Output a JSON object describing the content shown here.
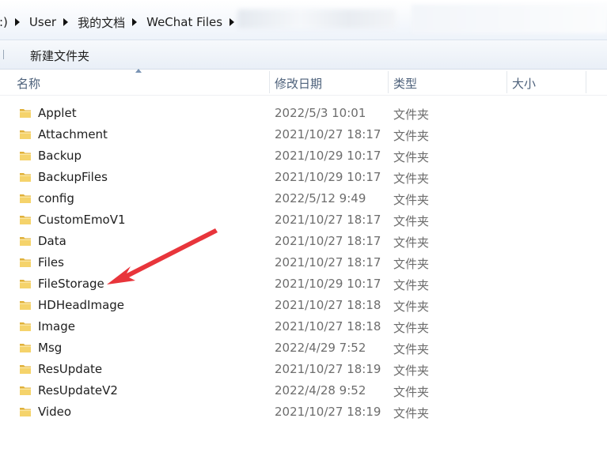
{
  "address_bar": {
    "crumbs": [
      ":)",
      "User",
      "我的文档",
      "WeChat Files"
    ]
  },
  "toolbar": {
    "new_folder_label": "新建文件夹"
  },
  "columns": {
    "name": "名称",
    "date": "修改日期",
    "type": "类型",
    "size": "大小"
  },
  "files": [
    {
      "name": "Applet",
      "date": "2022/5/3 10:01",
      "type": "文件夹"
    },
    {
      "name": "Attachment",
      "date": "2021/10/27 18:17",
      "type": "文件夹"
    },
    {
      "name": "Backup",
      "date": "2021/10/29 10:17",
      "type": "文件夹"
    },
    {
      "name": "BackupFiles",
      "date": "2021/10/29 10:17",
      "type": "文件夹"
    },
    {
      "name": "config",
      "date": "2022/5/12 9:49",
      "type": "文件夹"
    },
    {
      "name": "CustomEmoV1",
      "date": "2021/10/27 18:17",
      "type": "文件夹"
    },
    {
      "name": "Data",
      "date": "2021/10/27 18:17",
      "type": "文件夹"
    },
    {
      "name": "Files",
      "date": "2021/10/27 18:17",
      "type": "文件夹"
    },
    {
      "name": "FileStorage",
      "date": "2021/10/29 10:17",
      "type": "文件夹"
    },
    {
      "name": "HDHeadImage",
      "date": "2021/10/27 18:18",
      "type": "文件夹"
    },
    {
      "name": "Image",
      "date": "2021/10/27 18:18",
      "type": "文件夹"
    },
    {
      "name": "Msg",
      "date": "2022/4/29 7:52",
      "type": "文件夹"
    },
    {
      "name": "ResUpdate",
      "date": "2021/10/27 18:19",
      "type": "文件夹"
    },
    {
      "name": "ResUpdateV2",
      "date": "2022/4/28 9:52",
      "type": "文件夹"
    },
    {
      "name": "Video",
      "date": "2021/10/27 18:19",
      "type": "文件夹"
    }
  ],
  "colors": {
    "annotation_arrow": "#e8353b",
    "folder": "#f2c94c"
  },
  "annotation": {
    "points_to": "FileStorage"
  }
}
